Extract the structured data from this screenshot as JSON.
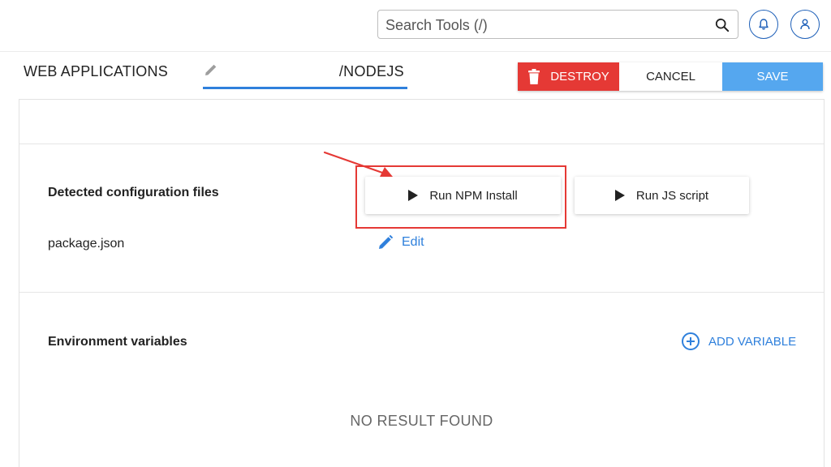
{
  "search": {
    "placeholder": "Search Tools (/)"
  },
  "header": {
    "section_title": "WEB APPLICATIONS",
    "app_name": "/NODEJS"
  },
  "actions": {
    "destroy_label": "DESTROY",
    "cancel_label": "CANCEL",
    "save_label": "SAVE"
  },
  "config": {
    "title": "Detected configuration files",
    "file_name": "package.json",
    "edit_label": "Edit",
    "run_npm_label": "Run NPM Install",
    "run_js_label": "Run JS script"
  },
  "env": {
    "title": "Environment variables",
    "add_label": "ADD VARIABLE",
    "empty_message": "NO RESULT FOUND"
  },
  "colors": {
    "accent_blue": "#2f80dc",
    "save_blue": "#55a7ef",
    "destroy_red": "#e53935",
    "annotation_red": "#e53935"
  },
  "icons": [
    "search-icon",
    "bell-icon",
    "user-icon",
    "pencil-icon",
    "trash-icon",
    "play-icon",
    "edit-pencil-icon",
    "add-circle-icon",
    "annotation-arrow"
  ]
}
